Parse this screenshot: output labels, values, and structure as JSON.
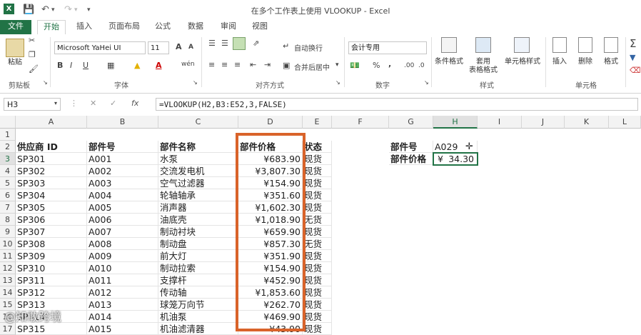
{
  "window": {
    "title": "在多个工作表上使用 VLOOKUP - Excel"
  },
  "tabs": [
    "文件",
    "开始",
    "插入",
    "页面布局",
    "公式",
    "数据",
    "审阅",
    "视图"
  ],
  "ribbon": {
    "clipboard": {
      "paste": "粘贴",
      "label": "剪贴板"
    },
    "font": {
      "name": "Microsoft YaHei UI",
      "size": "11",
      "label": "字体",
      "bold": "B",
      "italic": "I",
      "underline": "U",
      "grow": "A",
      "shrink": "A",
      "font_color": "A",
      "phonetic": "wén"
    },
    "alignment": {
      "wrap": "自动换行",
      "merge": "合并后居中",
      "label": "对齐方式"
    },
    "number": {
      "format": "会计专用",
      "label": "数字",
      "percent": "%",
      "comma": ",",
      "inc": ".00",
      "dec": ".0"
    },
    "styles": {
      "cond": "条件格式",
      "table1": "套用",
      "table2": "表格格式",
      "cell": "单元格样式",
      "label": "样式"
    },
    "cells": {
      "insert": "插入",
      "delete": "删除",
      "format": "格式",
      "label": "单元格"
    }
  },
  "formula_bar": {
    "name_box": "H3",
    "fx": "fx",
    "formula": "=VLOOKUP(H2,B3:E52,3,FALSE)"
  },
  "columns": [
    "A",
    "B",
    "C",
    "D",
    "E",
    "F",
    "G",
    "H",
    "I",
    "J",
    "K",
    "L"
  ],
  "rows": [
    "1",
    "2",
    "3",
    "4",
    "5",
    "6",
    "7",
    "8",
    "9",
    "10",
    "11",
    "12",
    "13",
    "14",
    "15",
    "16",
    "17"
  ],
  "table": {
    "headers": [
      "供应商 ID",
      "部件号",
      "部件名称",
      "部件价格",
      "状态"
    ],
    "data": [
      [
        "SP301",
        "A001",
        "水泵",
        "¥683.90",
        "现货"
      ],
      [
        "SP302",
        "A002",
        "交流发电机",
        "¥3,807.30",
        "现货"
      ],
      [
        "SP303",
        "A003",
        "空气过滤器",
        "¥154.90",
        "现货"
      ],
      [
        "SP304",
        "A004",
        "轮轴轴承",
        "¥351.60",
        "现货"
      ],
      [
        "SP305",
        "A005",
        "消声器",
        "¥1,602.30",
        "现货"
      ],
      [
        "SP306",
        "A006",
        "油底壳",
        "¥1,018.90",
        "无货"
      ],
      [
        "SP307",
        "A007",
        "制动衬块",
        "¥659.90",
        "现货"
      ],
      [
        "SP308",
        "A008",
        "制动盘",
        "¥857.30",
        "无货"
      ],
      [
        "SP309",
        "A009",
        "前大灯",
        "¥351.90",
        "现货"
      ],
      [
        "SP310",
        "A010",
        "制动拉索",
        "¥154.90",
        "现货"
      ],
      [
        "SP311",
        "A011",
        "支撑杆",
        "¥452.90",
        "现货"
      ],
      [
        "SP312",
        "A012",
        "传动轴",
        "¥1,853.60",
        "现货"
      ],
      [
        "SP313",
        "A013",
        "球笼万向节",
        "¥262.70",
        "现货"
      ],
      [
        "SP314",
        "A014",
        "机油泵",
        "¥469.90",
        "现货"
      ],
      [
        "SP315",
        "A015",
        "机油滤清器",
        "¥43.90",
        "现货"
      ]
    ]
  },
  "lookup": {
    "label1": "部件号",
    "value1": "A029",
    "label2": "部件价格",
    "value2_cur": "¥",
    "value2": "34.30"
  },
  "watermark": "@知敢跨境"
}
